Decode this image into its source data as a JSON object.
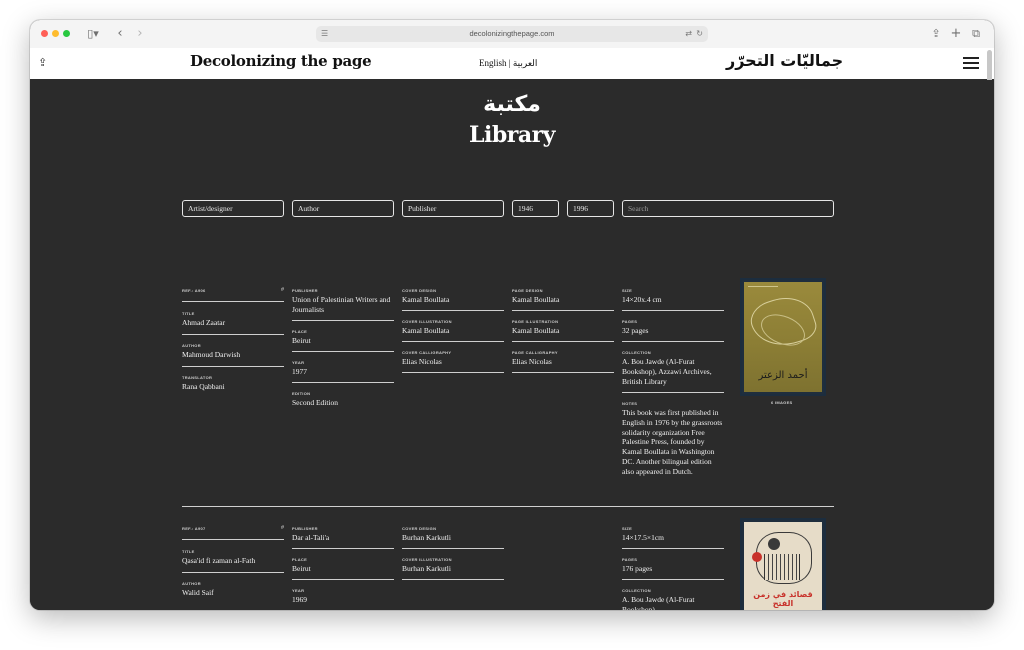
{
  "browser": {
    "url": "decolonizingthepage.com",
    "light_colors": [
      "#ff5f57",
      "#febc2e",
      "#28c840"
    ]
  },
  "site": {
    "logo_en": "Decolonizing the page",
    "lang_switch": "English | العربية",
    "logo_ar": "جماليّات التحرّر"
  },
  "page": {
    "title_ar": "مكتبة",
    "title_en": "Library"
  },
  "filters": {
    "artist": "Artist/designer",
    "author": "Author",
    "publisher": "Publisher",
    "year_from": "1946",
    "year_to": "1996",
    "search_placeholder": "Search"
  },
  "entries": [
    {
      "ref_label": "REF.: A906",
      "hash": "#",
      "title_label": "TITLE",
      "title": "Ahmad Zaatar",
      "author_label": "AUTHOR",
      "author": "Mahmoud Darwish",
      "translator_label": "TRANSLATOR",
      "translator": "Rana Qabbani",
      "publisher_label": "PUBLISHER",
      "publisher": "Union of Palestinian Writers and Journalists",
      "place_label": "PLACE",
      "place": "Beirut",
      "year_label": "YEAR",
      "year": "1977",
      "edition_label": "EDITION",
      "edition": "Second Edition",
      "cover_design_label": "COVER DESIGN",
      "cover_design": "Kamal Boullata",
      "cover_illustration_label": "COVER ILLUSTRATION",
      "cover_illustration": "Kamal Boullata",
      "cover_calligraphy_label": "COVER CALLIGRAPHY",
      "cover_calligraphy": "Elias Nicolas",
      "page_design_label": "PAGE DESIGN",
      "page_design": "Kamal Boullata",
      "page_illustration_label": "PAGE ILLUSTRATION",
      "page_illustration": "Kamal Boullata",
      "page_calligraphy_label": "PAGE CALLIGRAPHY",
      "page_calligraphy": "Elias Nicolas",
      "size_label": "SIZE",
      "size": "14×20x.4 cm",
      "pages_label": "PAGES",
      "pages": "32 pages",
      "collection_label": "COLLECTION",
      "collection": "A. Bou Jawde (Al-Furat Bookshop), Azzawi Archives, British Library",
      "notes_label": "NOTES",
      "notes": "This book was first published in English in 1976 by the grassroots solidarity organization Free Palestine Press, founded by Kamal Boullata in Washington DC. Another bilingual edition also appeared in Dutch.",
      "images": "6 IMAGES",
      "cover_text": "أحمد الزعتر"
    },
    {
      "ref_label": "REF.: A907",
      "hash": "#",
      "title_label": "TITLE",
      "title": "Qasa'id fi zaman al-Fath",
      "author_label": "AUTHOR",
      "author": "Walid Saif",
      "publisher_label": "PUBLISHER",
      "publisher": "Dar al-Tali'a",
      "place_label": "PLACE",
      "place": "Beirut",
      "year_label": "YEAR",
      "year": "1969",
      "cover_design_label": "COVER DESIGN",
      "cover_design": "Burhan Karkutli",
      "cover_illustration_label": "COVER ILLUSTRATION",
      "cover_illustration": "Burhan Karkutli",
      "size_label": "SIZE",
      "size": "14×17.5×1cm",
      "pages_label": "PAGES",
      "pages": "176 pages",
      "collection_label": "COLLECTION",
      "collection": "A. Bou Jawde (Al-Furat Bookshop)",
      "cover_text": "قصائد في زمن الفتح"
    }
  ]
}
